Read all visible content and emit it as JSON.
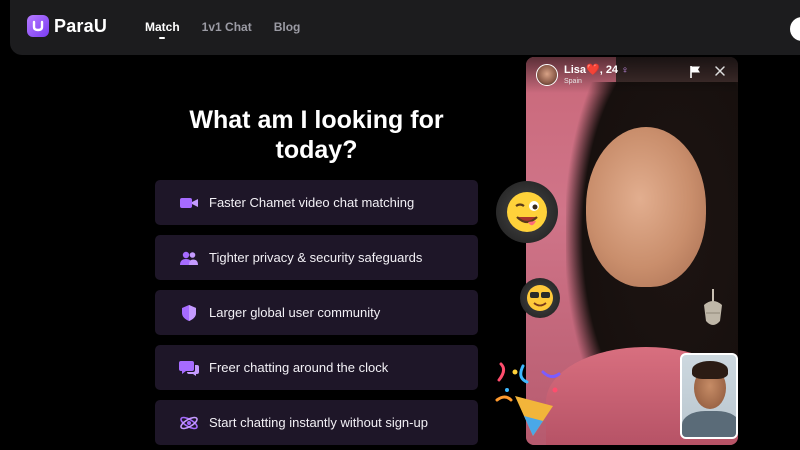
{
  "header": {
    "brand": "ParaU",
    "nav": [
      {
        "label": "Match",
        "active": true
      },
      {
        "label": "1v1 Chat",
        "active": false
      },
      {
        "label": "Blog",
        "active": false
      }
    ]
  },
  "hero": {
    "title": "What am I looking for today?"
  },
  "features": [
    {
      "icon": "video-camera-icon",
      "label": "Faster Chamet video chat matching"
    },
    {
      "icon": "users-icon",
      "label": "Tighter privacy & security safeguards"
    },
    {
      "icon": "shield-icon",
      "label": "Larger global user community"
    },
    {
      "icon": "chat-bubbles-icon",
      "label": "Freer chatting around the clock"
    },
    {
      "icon": "atom-icon",
      "label": "Start chatting instantly without sign-up"
    }
  ],
  "video_card": {
    "user_name": "Lisa❤️, 24",
    "user_country": "Spain",
    "gender_symbol": "♀"
  },
  "colors": {
    "accent": "#9b5cff",
    "card_bg": "#1e1628",
    "header_bg": "#1c1c1e",
    "page_bg": "#000000"
  }
}
